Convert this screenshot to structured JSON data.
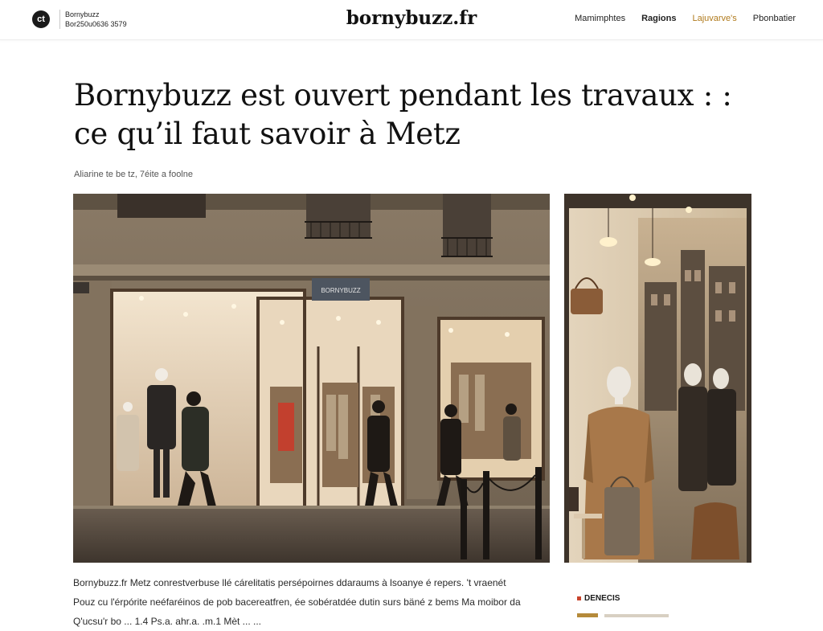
{
  "header": {
    "logo_glyph": "ct",
    "brand_line1": "Bornybuzz",
    "brand_line2": "Bor250u0636 3579",
    "site_title": "bornybuzz.fr",
    "nav": [
      {
        "label": "Mamimphtes",
        "style": "normal"
      },
      {
        "label": "Ragions",
        "style": "bold"
      },
      {
        "label": "Lajuvarve's",
        "style": "accent"
      },
      {
        "label": "Pbonbatier",
        "style": "normal"
      }
    ]
  },
  "article": {
    "headline": "Bornybuzz est ouvert pendant les travaux : : ce qu’il faut savoir à Metz",
    "byline": "Aliarine te be tz, 7éite a foolne",
    "main_image": {
      "sign_text": "BORNYBUZZ",
      "alt": "Storefront of Bornybuzz boutique in Metz at dusk with mannequins and passersby"
    },
    "side_image": {
      "alt": "Shop window with mannequins in coats and reflection of buildings"
    },
    "body_lines": [
      "Bornybuzz.fr Metz conrestverbuse llé cárelitatis persépoirnes ddaraums à lsoanye é repers. 't vraenét",
      "Pouz cu l'érpórite neéfaréinos de pob bacereatfren, ée sobératdée dutin surs bäné z bems Ma moibor da",
      "Q'ucsu'r bo ... 1.4 Ps.a. ahr.a. .m.1 Mèt ... ..."
    ]
  },
  "sidebar": {
    "label": "DENECIS",
    "accent_color": "#c9442c"
  },
  "colors": {
    "accent": "#b07a1c",
    "text": "#1b1b1b"
  }
}
